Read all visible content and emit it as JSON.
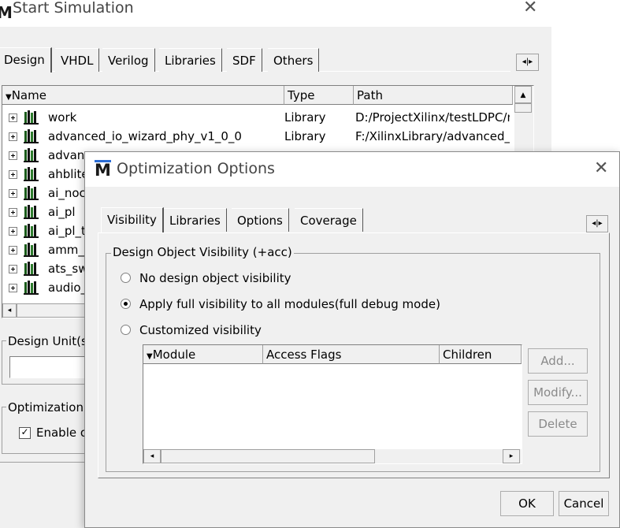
{
  "start_sim": {
    "title": "Start Simulation",
    "tabs": [
      "Design",
      "VHDL",
      "Verilog",
      "Libraries",
      "SDF",
      "Others"
    ],
    "columns": {
      "name": "Name",
      "type": "Type",
      "path": "Path"
    },
    "rows": [
      {
        "name": "work",
        "type": "Library",
        "path": "D:/ProjectXilinx/testLDPC/n"
      },
      {
        "name": "advanced_io_wizard_phy_v1_0_0",
        "type": "Library",
        "path": "F:/XilinxLibrary/advanced_i"
      },
      {
        "name": "advanc",
        "type": "",
        "path": ""
      },
      {
        "name": "ahblite",
        "type": "",
        "path": ""
      },
      {
        "name": "ai_noc",
        "type": "",
        "path": ""
      },
      {
        "name": "ai_pl",
        "type": "",
        "path": ""
      },
      {
        "name": "ai_pl_t",
        "type": "",
        "path": ""
      },
      {
        "name": "amm_a",
        "type": "",
        "path": ""
      },
      {
        "name": "ats_sw",
        "type": "",
        "path": ""
      },
      {
        "name": "audio_",
        "type": "",
        "path": ""
      }
    ],
    "design_units_label": "Design Unit(s)",
    "optimization_label": "Optimization",
    "enable_label": "Enable o"
  },
  "opt": {
    "title": "Optimization Options",
    "tabs": [
      "Visibility",
      "Libraries",
      "Options",
      "Coverage"
    ],
    "group_label": "Design Object Visibility (+acc)",
    "radios": [
      {
        "label": "No design object visibility",
        "selected": false
      },
      {
        "label": "Apply full visibility to all modules(full debug mode)",
        "selected": true
      },
      {
        "label": "Customized visibility",
        "selected": false
      }
    ],
    "columns": {
      "module": "Module",
      "flags": "Access Flags",
      "children": "Children"
    },
    "buttons": {
      "add": "Add...",
      "modify": "Modify...",
      "delete": "Delete",
      "ok": "OK",
      "cancel": "Cancel"
    }
  },
  "icons": {
    "app": "modelsim-m-icon",
    "library": "library-books-icon"
  }
}
